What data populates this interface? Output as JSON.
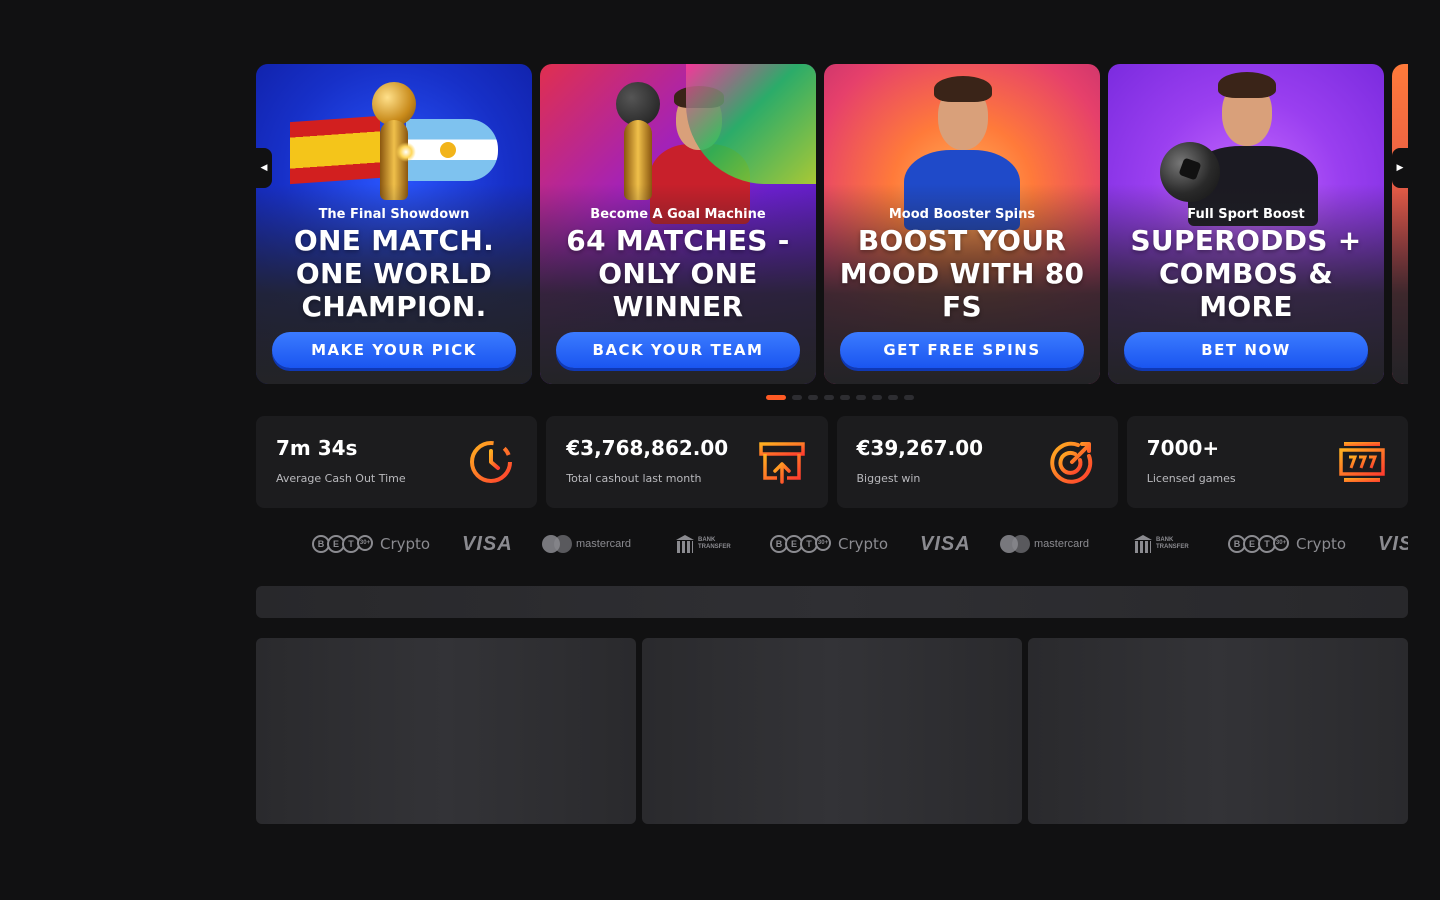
{
  "promos": [
    {
      "subtitle": "The Final Showdown",
      "title": "ONE MATCH. ONE WORLD CHAMPION.",
      "cta": "MAKE YOUR PICK"
    },
    {
      "subtitle": "Become A Goal Machine",
      "title": "64 MATCHES - ONLY ONE WINNER",
      "cta": "BACK YOUR TEAM"
    },
    {
      "subtitle": "Mood Booster Spins",
      "title": "BOOST YOUR MOOD WITH 80 FS",
      "cta": "GET FREE SPINS"
    },
    {
      "subtitle": "Full Sport Boost",
      "title": "SUPERODDS + COMBOS & MORE",
      "cta": "BET NOW"
    }
  ],
  "carousel": {
    "prev_icon": "◀",
    "next_icon": "▶",
    "dot_count": 9,
    "active_dot": 0
  },
  "stats": [
    {
      "value": "7m 34s",
      "label": "Average Cash Out Time",
      "icon": "stopwatch-icon"
    },
    {
      "value": "€3,768,862.00",
      "label": "Total cashout last month",
      "icon": "cashout-icon"
    },
    {
      "value": "€39,267.00",
      "label": "Biggest win",
      "icon": "target-icon"
    },
    {
      "value": "7000+",
      "label": "Licensed games",
      "icon": "slot-machine-icon"
    }
  ],
  "payments": {
    "crypto_label": "Crypto",
    "crypto_coins": [
      "B",
      "E",
      "T",
      "30+"
    ],
    "visa_label": "VISA",
    "mastercard_label": "mastercard",
    "bank_label_1": "BANK",
    "bank_label_2": "TRANSFER"
  },
  "colors": {
    "accent": "#ff5a24",
    "cta_blue": "#1a55f0",
    "background": "#111112",
    "card": "#1c1c1e"
  }
}
